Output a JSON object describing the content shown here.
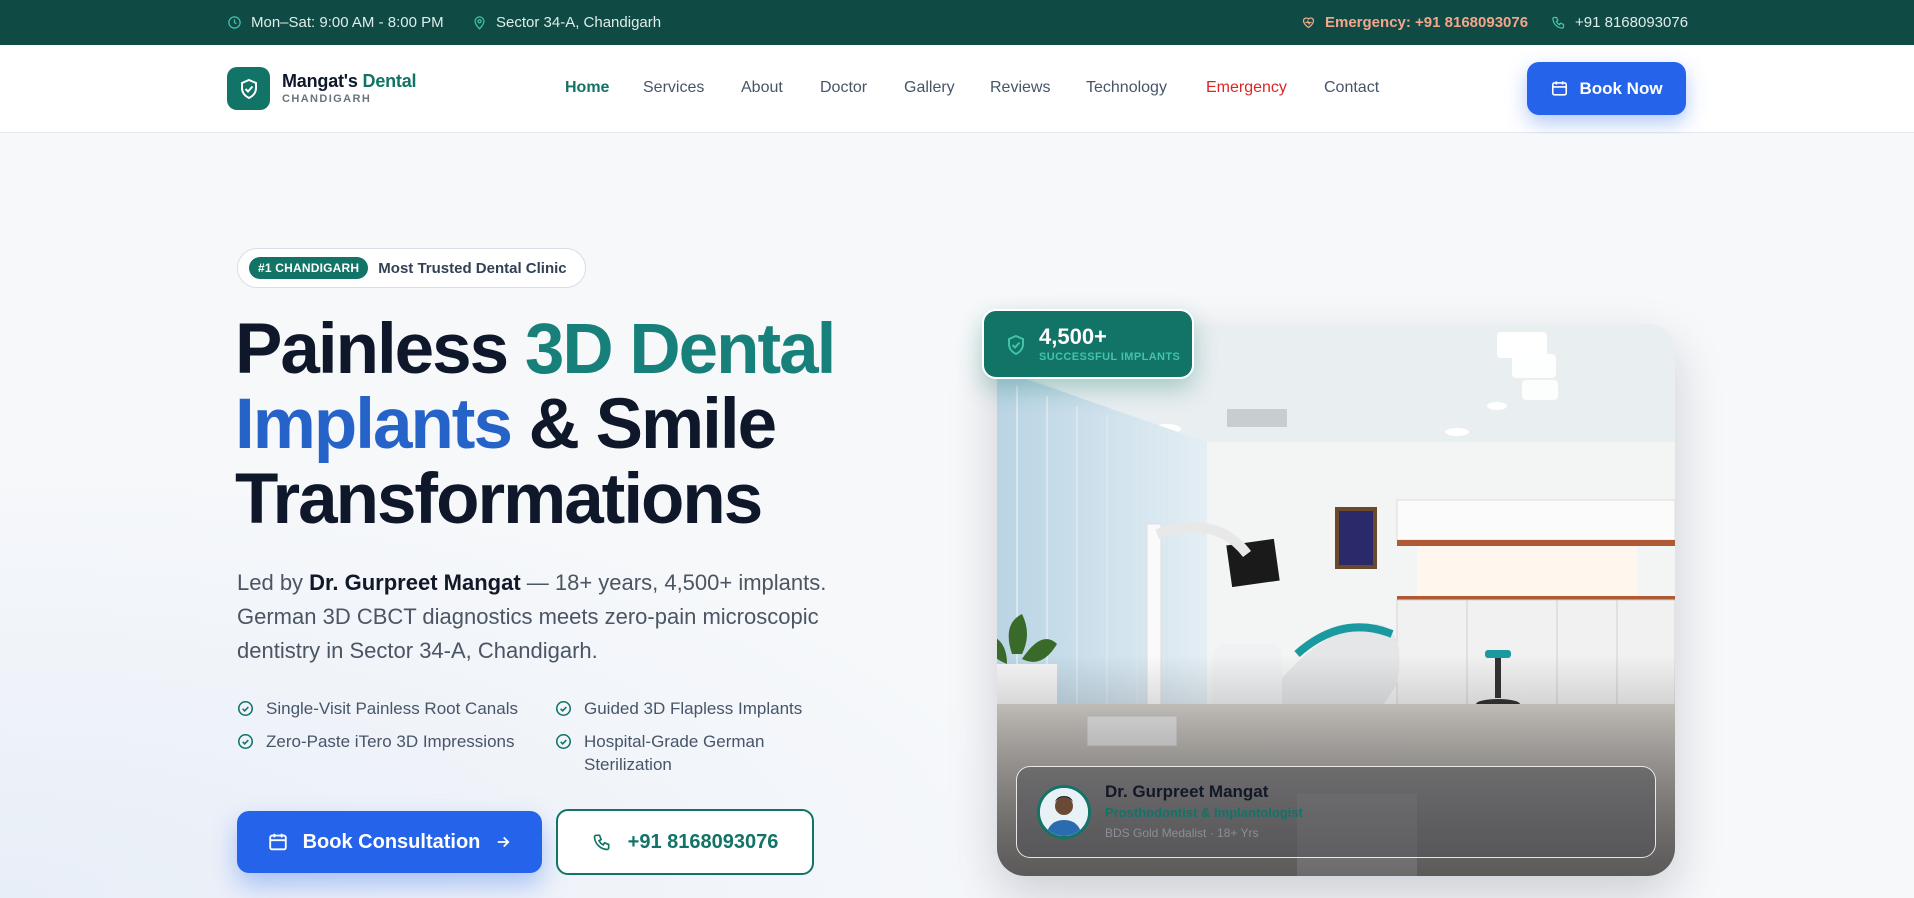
{
  "topbar": {
    "hours": "Mon–Sat: 9:00 AM - 8:00 PM",
    "address": "Sector 34-A, Chandigarh",
    "emergency": "Emergency: +91 8168093076",
    "phone": "+91 8168093076"
  },
  "brand": {
    "name_main": "Mangat's",
    "name_accent": "Dental",
    "subtitle": "CHANDIGARH"
  },
  "nav": {
    "items": [
      {
        "label": "Home"
      },
      {
        "label": "Services"
      },
      {
        "label": "About"
      },
      {
        "label": "Doctor"
      },
      {
        "label": "Gallery"
      },
      {
        "label": "Reviews"
      },
      {
        "label": "Technology"
      },
      {
        "label": "Emergency"
      },
      {
        "label": "Contact"
      }
    ],
    "cta": "Book Now"
  },
  "hero": {
    "badge_tag": "#1 CHANDIGARH",
    "badge_text": "Most Trusted Dental Clinic",
    "title_part1": "Painless ",
    "title_accent1": "3D Dental",
    "title_accent2": "Implants",
    "title_part2": " & Smile",
    "title_part3": "Transformations",
    "lead_prefix": "Led by ",
    "lead_name": "Dr. Gurpreet Mangat",
    "lead_rest": " — 18+ years, 4,500+ implants. German 3D CBCT diagnostics meets zero-pain microscopic dentistry in Sector 34-A, Chandigarh.",
    "features": [
      "Single-Visit Painless Root Canals",
      "Guided 3D Flapless Implants",
      "Zero-Paste iTero 3D Impressions",
      "Hospital-Grade German Sterilization"
    ],
    "primary_cta": "Book Consultation",
    "phone_cta": "+91 8168093076"
  },
  "stat": {
    "number": "4,500+",
    "label": "SUCCESSFUL IMPLANTS"
  },
  "doctor_card": {
    "name": "Dr. Gurpreet Mangat",
    "role": "Prosthodontist & Implantologist",
    "meta": "BDS Gold Medalist · 18+ Yrs"
  },
  "colors": {
    "brand_teal": "#127367",
    "primary_blue": "#2563eb",
    "topbar_bg": "#0f4a44",
    "emergency_red": "#dc2626"
  }
}
